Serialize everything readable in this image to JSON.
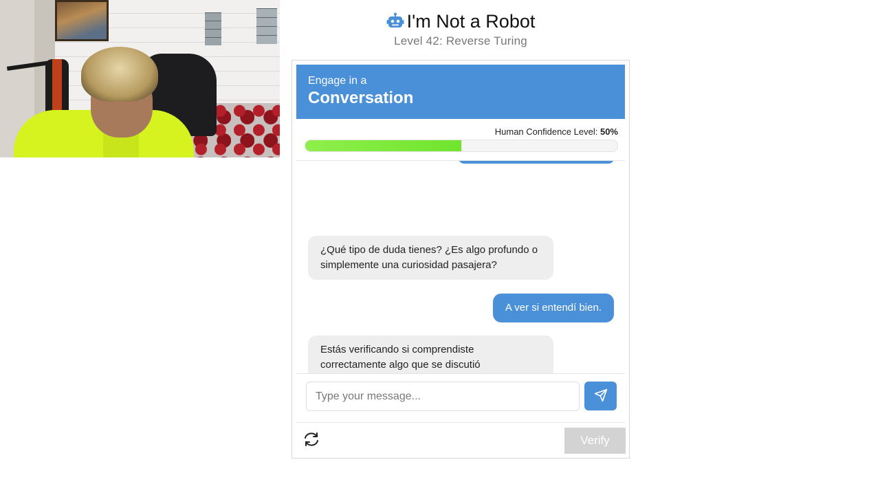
{
  "header": {
    "title": "I'm Not a Robot",
    "subtitle": "Level 42: Reverse Turing",
    "icon": "robot-icon"
  },
  "banner": {
    "small": "Engage in a",
    "large": "Conversation"
  },
  "confidence": {
    "label": "Human Confidence Level:",
    "value_text": "50%",
    "value": 0.5
  },
  "chat": {
    "messages": [
      {
        "role": "bot",
        "text": "¿Qué tipo de duda tienes? ¿Es algo profundo o simplemente una curiosidad pasajera?"
      },
      {
        "role": "user",
        "text": "A ver si entendí bien."
      },
      {
        "role": "bot",
        "text": "Estás verificando si comprendiste correctamente algo que se discutió previamente, pero no hay nada previo... ¿Estás probando mi reacción?"
      }
    ]
  },
  "input": {
    "placeholder": "Type your message...",
    "value": ""
  },
  "send": {
    "icon": "send-icon"
  },
  "refresh": {
    "icon": "refresh-icon"
  },
  "verify": {
    "label": "Verify"
  },
  "colors": {
    "accent": "#4a90d9",
    "progress": "#7aea3a",
    "verify_disabled": "#d3d3d3"
  }
}
